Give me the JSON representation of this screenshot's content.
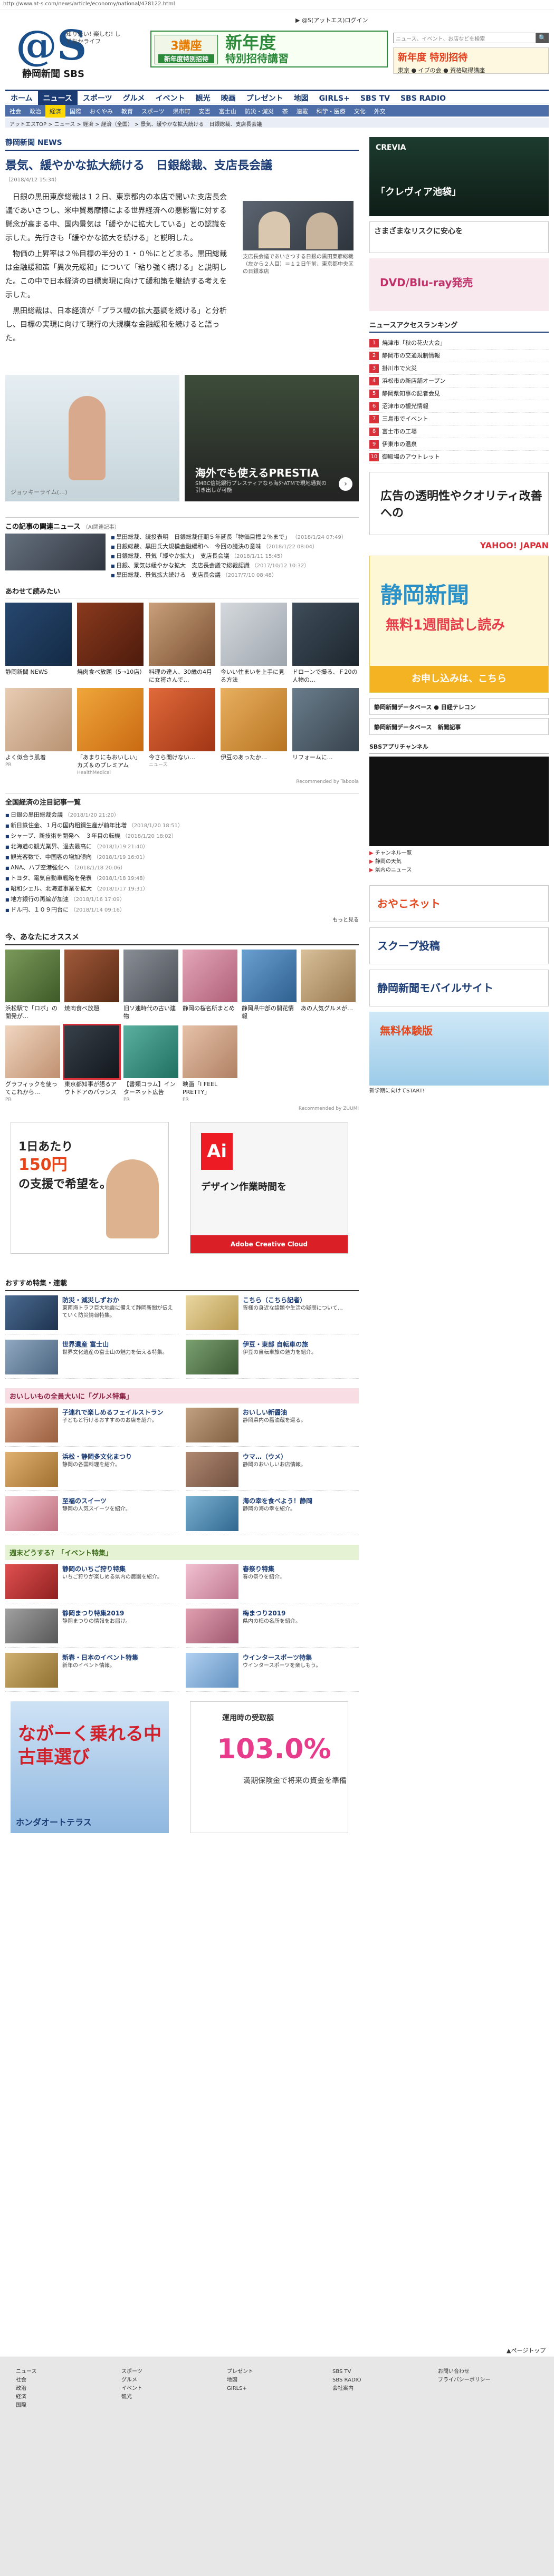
{
  "url": "http://www.at-s.com/news/article/economy/national/478122.html",
  "top_links": "▶ @S(アットエス)ログイン",
  "site": {
    "logo_mark": "@S",
    "tagline": "知りたい! 楽しむ! しずおかライフ",
    "name": "静岡新聞 SBS"
  },
  "header_banner": {
    "badge_line1": "3講座",
    "badge_line2": "新年度特別招待",
    "headline": "新年度",
    "headline2": "特別招待講習"
  },
  "search": {
    "placeholder": "ニュース、イベント、お店などを検索"
  },
  "header_side_banner": {
    "title": "新年度 特別招待",
    "sub": "東京 ● イブの会 ● 資格取得講座"
  },
  "gnav": [
    "ホーム",
    "ニュース",
    "スポーツ",
    "グルメ",
    "イベント",
    "観光",
    "映画",
    "プレゼント",
    "地図",
    "GIRLS+",
    "SBS TV",
    "SBS RADIO"
  ],
  "subnav": [
    "社会",
    "政治",
    "経済",
    "国際",
    "おくやみ",
    "教育",
    "スポーツ",
    "県市町",
    "安否",
    "富士山",
    "防災・減災",
    "茶",
    "連載",
    "科学・医療",
    "文化",
    "外交"
  ],
  "breadcrumb": "アットエスTOP > ニュース > 経済 > 経済（全国） > 景気、緩やかな拡大続ける　日銀総裁、支店長会議",
  "section_label": "静岡新聞 NEWS",
  "article": {
    "title": "景気、緩やかな拡大続ける　日銀総裁、支店長会議",
    "date": "（2018/4/12 15:34）",
    "paragraphs": [
      "日銀の黒田東彦総裁は１２日、東京都内の本店で開いた支店長会議であいさつし、米中貿易摩擦による世界経済への悪影響に対する懸念が高まる中、国内景気は「緩やかに拡大している」との認識を示した。先行きも「緩やかな拡大を続ける」と説明した。",
      "物価の上昇率は２％目標の半分の１・０％にとどまる。黒田総裁は金融緩和策「異次元緩和」について「粘り強く続ける」と説明した。この中で日本経済の目標実現に向けて緩和策を継続する考えを示した。",
      "黒田総裁は、日本経済が「プラス幅の拡大基調を続ける」と分析し、目標の実現に向けて現行の大規模な金融緩和を続けると語った。"
    ],
    "photo_caption": "支店長会議であいさつする日銀の黒田東彦総裁（左から２人目）＝１２日午前、東京都中央区の日銀本店"
  },
  "ads": {
    "left_label": "ジョッキーライム(…)",
    "right_title": "海外でも使えるPRESTIA",
    "right_sub": "SMBC信託銀行プレスティアなら海外ATMで現地通貨の引き出しが可能"
  },
  "related": {
    "heading": "この記事の関連ニュース",
    "heading_sub": "（AI関連記事）",
    "items": [
      {
        "text": "黒田総裁、続投表明　日銀総裁任期５年延長「物価目標２％まで」",
        "date": "（2018/1/24 07:49）"
      },
      {
        "text": "日銀総裁、黒田氏大規模金融緩和へ　今回の議決の意味",
        "date": "（2018/1/22 08:04）"
      },
      {
        "text": "日銀総裁、景気「緩やか拡大」　支店長会議",
        "date": "（2018/1/11 15:45）"
      },
      {
        "text": "日銀、景気は緩やかな拡大　支店長会議で総裁認識",
        "date": "（2017/10/12 10:32）"
      },
      {
        "text": "黒田総裁、景気拡大続ける　支店長会議",
        "date": "（2017/7/10 08:48）"
      }
    ]
  },
  "read_too": {
    "heading": "あわせて読みたい",
    "cards": [
      {
        "title": "静岡新聞 NEWS",
        "sub": ""
      },
      {
        "title": "焼肉食べ放題（5→10店）",
        "sub": ""
      },
      {
        "title": "料理の達人、30歳の4月に女将さんで…",
        "sub": ""
      },
      {
        "title": "今いい住まいを上手に見る方法",
        "sub": ""
      },
      {
        "title": "ドローンで撮る、Ｆ20の人物の…",
        "sub": ""
      },
      {
        "title": "よく似合う肌着",
        "sub": "PR"
      },
      {
        "title": "「あまりにもおいしい」カズ＆のプレミアム",
        "sub": "HealthMedical"
      },
      {
        "title": "今さら聞けない…",
        "sub": "ニュース"
      },
      {
        "title": "伊豆のあったか…",
        "sub": ""
      },
      {
        "title": "リフォームに…",
        "sub": ""
      }
    ],
    "note": "Recommended by Taboola"
  },
  "national": {
    "heading": "全国経済の注目記事一覧",
    "items": [
      {
        "text": "日銀の黒田総裁会議",
        "date": "（2018/1/20 21:20）"
      },
      {
        "text": "新日鉄住金、１月の国内粗鋼生産が前年比増",
        "date": "（2018/1/20 18:51）"
      },
      {
        "text": "シャープ、新技術を開発へ　３年目の転機",
        "date": "（2018/1/20 18:02）"
      },
      {
        "text": "北海道の観光業界、過去最高に",
        "date": "（2018/1/19 21:40）"
      },
      {
        "text": "観光客数で、中国客の増加傾向",
        "date": "（2018/1/19 16:01）"
      },
      {
        "text": "ANA、ハブ空港強化へ",
        "date": "（2018/1/18 20:06）"
      },
      {
        "text": "トヨタ、電気自動車戦略を発表",
        "date": "（2018/1/18 19:48）"
      },
      {
        "text": "昭和シェル、北海道事業を拡大",
        "date": "（2018/1/17 19:31）"
      },
      {
        "text": "地方銀行の再編が加速",
        "date": "（2018/1/16 17:09）"
      },
      {
        "text": "ドル円、１０９円台に",
        "date": "（2018/1/14 09:16）"
      }
    ],
    "more": "もっと見る"
  },
  "osusume": {
    "heading": "今、あなたにオススメ",
    "cards": [
      {
        "title": "浜松駅で「ロボ」の開発が…",
        "sub": ""
      },
      {
        "title": "焼肉食べ放題",
        "sub": ""
      },
      {
        "title": "旧ソ連時代の古い建物",
        "sub": ""
      },
      {
        "title": "静岡の桜名所まとめ",
        "sub": ""
      },
      {
        "title": "静岡県中部の開花情報",
        "sub": ""
      },
      {
        "title": "あの人気グルメが…",
        "sub": ""
      },
      {
        "title": "グラフィックを使ってこれから…",
        "sub": "PR"
      },
      {
        "title": "東京都知事が語るアウトドアのバランス",
        "sub": ""
      },
      {
        "title": "【書類コラム】インターネット広告",
        "sub": "PR"
      },
      {
        "title": "映画「I FEEL PRETTY」",
        "sub": "PR"
      }
    ],
    "note": "Recommended by ZUUMI"
  },
  "bottom_ads": {
    "ad1_line1": "1日あたり",
    "ad1_price": "150円",
    "ad1_line2": "の支援で希望を。",
    "ad2_logo": "Ai",
    "ad2_title": "デザイン作業時間を",
    "ad2_footer": "Adobe Creative Cloud"
  },
  "features": {
    "heading": "おすすめ特集・連載",
    "items": [
      {
        "title": "防災・減災しずおか",
        "desc": "東南海トラフ巨大地震に備えて静岡新聞が伝えていく防災情報特集。"
      },
      {
        "title": "こちら（こちら記者）",
        "desc": "皆様の身近な話題や生活の疑問について…"
      },
      {
        "title": "世界遺産 富士山",
        "desc": "世界文化遺産の富士山の魅力を伝える特集。"
      },
      {
        "title": "伊豆・東部 自転車の旅",
        "desc": "伊豆の自転車旅の魅力を紹介。"
      }
    ]
  },
  "gourmet": {
    "heading": "おいしいもの全員大いに「グルメ特集」",
    "items": [
      {
        "title": "子連れで楽しめるフェイルストラン",
        "desc": "子どもと行けるおすすめのお店を紹介。"
      },
      {
        "title": "おいしい新醤油",
        "desc": "静岡県内の醤油蔵を巡る。"
      },
      {
        "title": "浜松・静岡多文化まつり",
        "desc": "静岡の各国料理を紹介。"
      },
      {
        "title": "ウマ…（ウメ）",
        "desc": "静岡のおいしいお店情報。"
      },
      {
        "title": "至福のスイーツ",
        "desc": "静岡の人気スイーツを紹介。"
      },
      {
        "title": "海の幸を食べよう！静岡",
        "desc": "静岡の海の幸を紹介。"
      }
    ]
  },
  "events": {
    "heading": "週末どうする？「イベント特集」",
    "items": [
      {
        "title": "静岡のいちご狩り特集",
        "desc": "いちご狩りが楽しめる県内の農園を紹介。"
      },
      {
        "title": "春祭り特集",
        "desc": "春の祭りを紹介。"
      },
      {
        "title": "静岡まつり特集2019",
        "desc": "静岡まつりの情報をお届け。"
      },
      {
        "title": "梅まつり2019",
        "desc": "県内の梅の名所を紹介。"
      },
      {
        "title": "新春・日本のイベント特集",
        "desc": "新年のイベント情報。"
      },
      {
        "title": "ウインタースポーツ特集",
        "desc": "ウインタースポーツを楽しもう。"
      }
    ]
  },
  "last_ads": {
    "ad1_text": "ながーく乗れる中古車選び",
    "ad1_footer": "ホンダオートテラス",
    "ad2_title": "運用時の受取額",
    "ad2_pct": "103.0%",
    "ad2_sub": "満期保険金で将来の資金を準備"
  },
  "sidebar": {
    "ad1_title": "CREVIA",
    "ad1_sub": "「クレヴィア池袋」",
    "ad2_text": "さまざまなリスクに安心を",
    "ad3_text": "DVD/Blu-ray発売",
    "ranking_heading": "ニュースアクセスランキング",
    "ranking": [
      "焼津市「秋の花火大会」",
      "静岡市の交通規制情報",
      "掛川市で火災",
      "浜松市の新店舗オープン",
      "静岡県知事の記者会見",
      "沼津市の観光情報",
      "三島市でイベント",
      "富士市の工場",
      "伊東市の温泉",
      "御殿場のアウトレット"
    ],
    "box_text": "広告の透明性やクオリティ改善への",
    "yahoo": "YAHOO! JAPAN",
    "shiz_title": "静岡新聞",
    "shiz_sub": "無料1週間試し読み",
    "shiz_footer": "お申し込みは、こちら",
    "db1": "静岡新聞データベース ● 日経テレコン",
    "db2": "静岡新聞データベース　新聞記事",
    "tv_heading": "SBSアプリチャンネル",
    "tv_items": [
      "チャンネル一覧",
      "静岡の天気",
      "県内のニュース"
    ],
    "small1": "おやこネット",
    "small2": "スクープ投稿",
    "small3": "静岡新聞モバイルサイト",
    "last_title": "無料体験版",
    "last_cap": "新学期に向けてSTART!"
  },
  "pagetop": "▲ページトップ",
  "footer_cols": [
    [
      "ニュース",
      "社会",
      "政治",
      "経済",
      "国際"
    ],
    [
      "スポーツ",
      "グルメ",
      "イベント",
      "観光"
    ],
    [
      "プレゼント",
      "地図",
      "GIRLS+"
    ],
    [
      "SBS TV",
      "SBS RADIO",
      "会社案内"
    ],
    [
      "お問い合わせ",
      "プライバシーポリシー"
    ]
  ]
}
